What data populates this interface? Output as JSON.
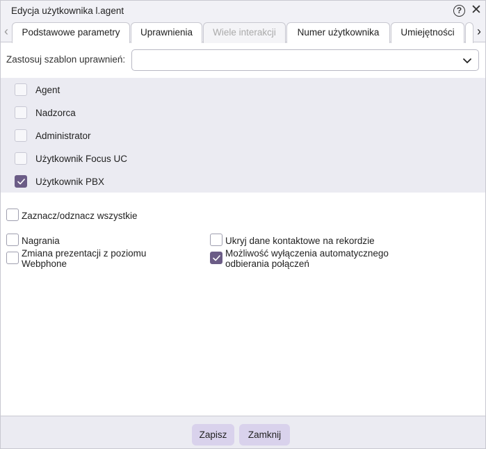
{
  "dialog": {
    "title": "Edycja użytkownika l.agent",
    "help_icon": "help-icon",
    "close_icon": "close-icon"
  },
  "tabs": [
    {
      "label": "Podstawowe parametry",
      "state": "normal"
    },
    {
      "label": "Uprawnienia",
      "state": "active"
    },
    {
      "label": "Wiele interakcji",
      "state": "disabled"
    },
    {
      "label": "Numer użytkownika",
      "state": "normal"
    },
    {
      "label": "Umiejętności",
      "state": "normal"
    }
  ],
  "template": {
    "label": "Zastosuj szablon uprawnień:",
    "value": ""
  },
  "roles": [
    {
      "label": "Agent",
      "checked": false
    },
    {
      "label": "Nadzorca",
      "checked": false
    },
    {
      "label": "Administrator",
      "checked": false
    },
    {
      "label": "Użytkownik Focus UC",
      "checked": false
    },
    {
      "label": "Użytkownik PBX",
      "checked": true
    }
  ],
  "select_all": {
    "label": "Zaznacz/odznacz wszystkie",
    "checked": false
  },
  "options": {
    "recordings": {
      "label": "Nagrania",
      "checked": false
    },
    "hide_contact": {
      "label": "Ukryj dane kontaktowe na rekordzie",
      "checked": false
    },
    "presentation_line1": "Zmiana prezentacji z poziomu",
    "presentation_line2": "Webphone",
    "presentation_checked": false,
    "auto_answer_line1": "Możliwość wyłączenia automatycznego",
    "auto_answer_line2": "odbierania połączeń",
    "auto_answer_checked": true
  },
  "footer": {
    "save_label": "Zapisz",
    "close_label": "Zamknij"
  },
  "colors": {
    "accent": "#6b5c86",
    "button_bg": "#d9d2ec",
    "panel_bg": "#ebebf2"
  }
}
